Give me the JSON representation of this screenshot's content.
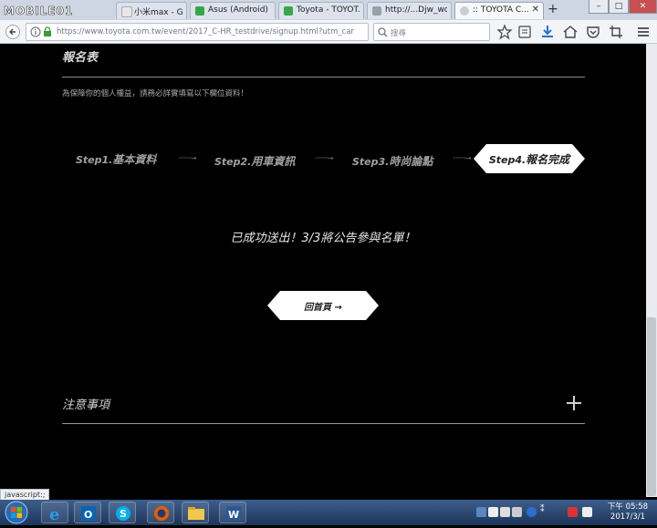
{
  "browser": {
    "tabs": [
      {
        "label": "小米max - Goo..."
      },
      {
        "label": "Asus (Android) ..."
      },
      {
        "label": "Toyota - TOYOT..."
      },
      {
        "label": "http://...Djw_wcB"
      },
      {
        "label": ":: TOYOTA C..."
      }
    ],
    "active_tab_index": 4,
    "new_tab_label": "+",
    "logo_text": "MOBILE01",
    "url": "https://www.toyota.com.tw/event/2017_C-HR_testdrive/signup.html?utm_car",
    "search_placeholder": "搜尋",
    "window_controls": {
      "minimize": "–",
      "maximize": "□",
      "close": "✕"
    }
  },
  "page": {
    "form_title": "報名表",
    "form_description": "為保障你的個人權益，請務必詳實填寫以下欄位資料！",
    "steps": [
      {
        "prefix": "Step1.",
        "label": "基本資料"
      },
      {
        "prefix": "Step2.",
        "label": "用車資訊"
      },
      {
        "prefix": "Step3.",
        "label": "時尚論點"
      },
      {
        "prefix": "Step4.",
        "label": "報名完成"
      }
    ],
    "current_step_index": 3,
    "step_separator": "·········→",
    "success_message": "已成功送出！3/3將公告參與名單！",
    "home_button_label": "回首頁 →",
    "notes_title": "注意事項",
    "accent_colors": {
      "background": "#000000",
      "text_light": "#e6e6e6",
      "step_muted": "#a0a0a0",
      "badge_bg": "#ffffff"
    }
  },
  "status_link": "javascript:;",
  "taskbar": {
    "clock_time": "下午 05:58",
    "clock_date": "2017/3/1"
  }
}
